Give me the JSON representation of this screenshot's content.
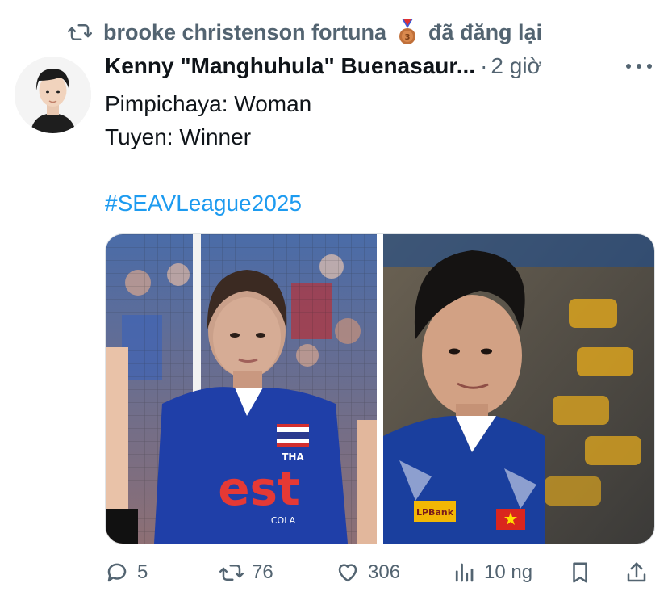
{
  "repost": {
    "name": "brooke christenson fortuna",
    "suffix": "đã đăng lại"
  },
  "tweet": {
    "author": "Kenny \"Manghuhula\" Buenasaur...",
    "separator": "·",
    "time": "2 giờ",
    "lines": [
      "Pimpichaya: Woman",
      "Tuyen: Winner"
    ],
    "hashtag": "#SEAVLeague2025"
  },
  "media": {
    "left_jersey_text": "est",
    "left_jersey_sub": "COLA",
    "left_flag_label": "THA",
    "right_sponsor": "LPBank"
  },
  "actions": {
    "replies": "5",
    "reposts": "76",
    "likes": "306",
    "views": "10 ng"
  },
  "colors": {
    "secondary_text": "#536471",
    "link": "#1d9bf0"
  }
}
